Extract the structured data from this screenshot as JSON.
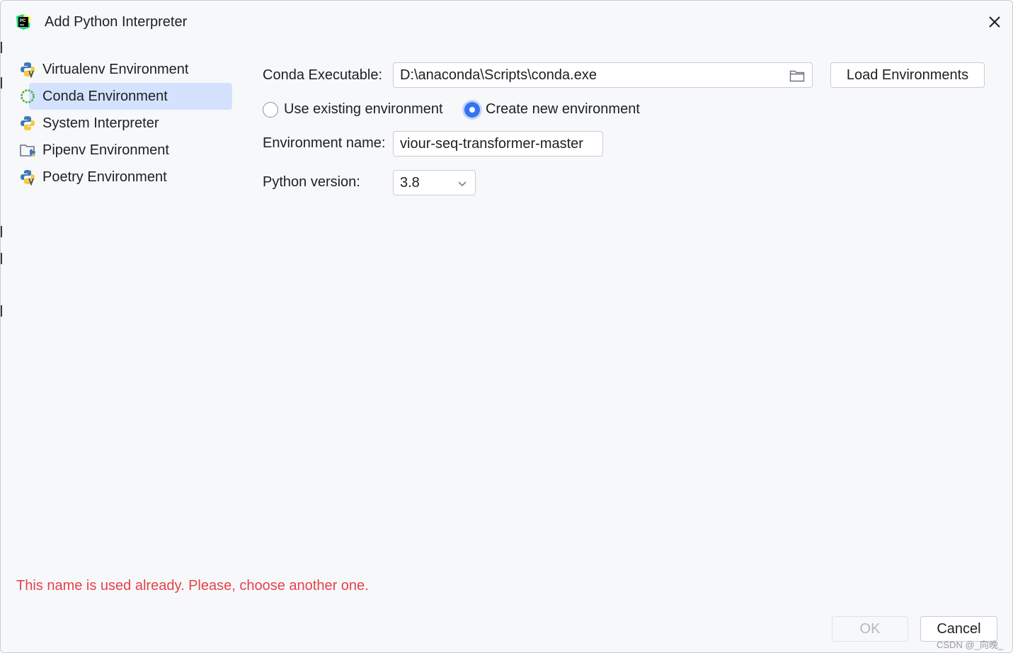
{
  "window": {
    "title": "Add Python Interpreter",
    "app_icon": "pycharm-logo",
    "close_icon": "close-icon"
  },
  "sidebar": {
    "items": [
      {
        "label": "Virtualenv Environment",
        "icon": "virtualenv-python-icon",
        "selected": false
      },
      {
        "label": "Conda Environment",
        "icon": "conda-ring-icon",
        "selected": true
      },
      {
        "label": "System Interpreter",
        "icon": "python-icon",
        "selected": false
      },
      {
        "label": "Pipenv Environment",
        "icon": "pipenv-folder-icon",
        "selected": false
      },
      {
        "label": "Poetry Environment",
        "icon": "poetry-python-icon",
        "selected": false
      }
    ]
  },
  "form": {
    "conda_label": "Conda Executable:",
    "conda_value": "D:\\anaconda\\Scripts\\conda.exe",
    "browse_icon": "folder-icon",
    "load_button": "Load Environments",
    "radio_existing": "Use existing environment",
    "radio_new": "Create new environment",
    "selected_radio": "new",
    "env_name_label": "Environment name:",
    "env_name_value": "viour-seq-transformer-master",
    "python_version_label": "Python version:",
    "python_version_value": "3.8",
    "dropdown_icon": "chevron-down-icon"
  },
  "error_message": "This name is used already. Please, choose another one.",
  "footer": {
    "ok_label": "OK",
    "cancel_label": "Cancel",
    "ok_enabled": false
  },
  "watermark": "CSDN @_向晚_",
  "colors": {
    "background": "#f7f8fa",
    "selection": "#d4e2ff",
    "accent": "#3574f0",
    "error": "#e5424b",
    "border": "#c9ccd6"
  }
}
